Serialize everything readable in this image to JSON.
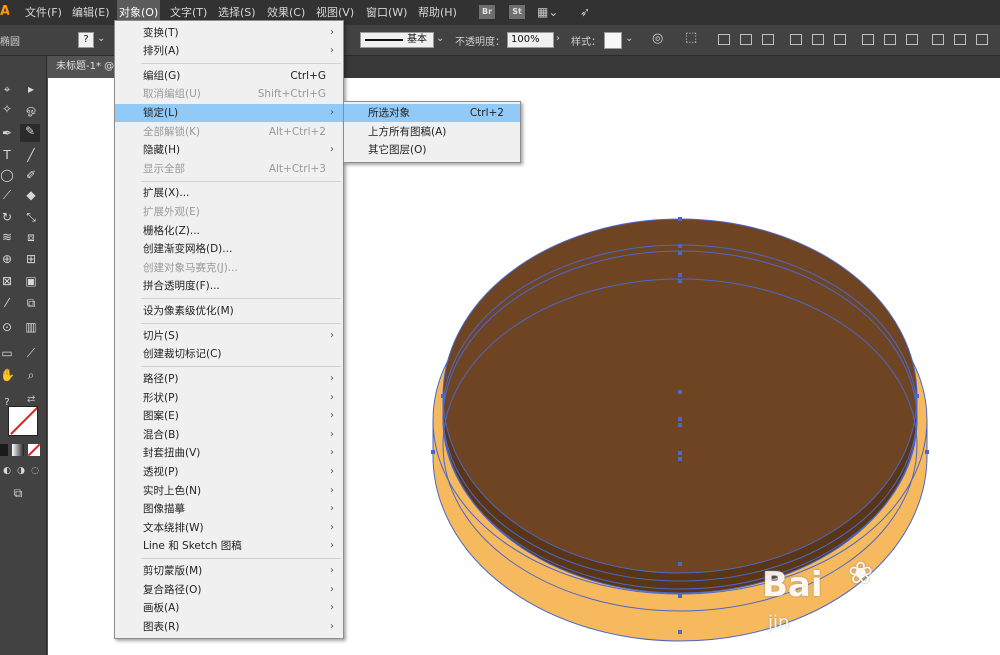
{
  "app": {
    "logo": "Ai"
  },
  "menubar": {
    "items": [
      "文件(F)",
      "编辑(E)",
      "对象(O)",
      "文字(T)",
      "选择(S)",
      "效果(C)",
      "视图(V)",
      "窗口(W)",
      "帮助(H)"
    ],
    "bridge": "Br",
    "stock": "St"
  },
  "control_bar": {
    "tool_label": "椭圆",
    "stroke_style": "基本",
    "opacity_label": "不透明度：",
    "opacity_value": "100%",
    "style_label": "样式："
  },
  "tab": {
    "title": "未标题-1* @"
  },
  "object_menu": {
    "items": [
      {
        "label": "变换(T)",
        "shortcut": "",
        "submenu": true,
        "disabled": false
      },
      {
        "label": "排列(A)",
        "shortcut": "",
        "submenu": true,
        "disabled": false
      },
      {
        "label": "编组(G)",
        "shortcut": "Ctrl+G",
        "submenu": false,
        "disabled": false
      },
      {
        "label": "取消编组(U)",
        "shortcut": "Shift+Ctrl+G",
        "submenu": false,
        "disabled": true
      },
      {
        "label": "锁定(L)",
        "shortcut": "",
        "submenu": true,
        "disabled": false,
        "highlight": true
      },
      {
        "label": "全部解锁(K)",
        "shortcut": "Alt+Ctrl+2",
        "submenu": false,
        "disabled": true
      },
      {
        "label": "隐藏(H)",
        "shortcut": "",
        "submenu": true,
        "disabled": false
      },
      {
        "label": "显示全部",
        "shortcut": "Alt+Ctrl+3",
        "submenu": false,
        "disabled": true
      },
      {
        "label": "扩展(X)...",
        "shortcut": "",
        "submenu": false,
        "disabled": false
      },
      {
        "label": "扩展外观(E)",
        "shortcut": "",
        "submenu": false,
        "disabled": true
      },
      {
        "label": "栅格化(Z)...",
        "shortcut": "",
        "submenu": false,
        "disabled": false
      },
      {
        "label": "创建渐变网格(D)...",
        "shortcut": "",
        "submenu": false,
        "disabled": false
      },
      {
        "label": "创建对象马赛克(J)...",
        "shortcut": "",
        "submenu": false,
        "disabled": true
      },
      {
        "label": "拼合透明度(F)...",
        "shortcut": "",
        "submenu": false,
        "disabled": false
      },
      {
        "label": "设为像素级优化(M)",
        "shortcut": "",
        "submenu": false,
        "disabled": false
      },
      {
        "label": "切片(S)",
        "shortcut": "",
        "submenu": true,
        "disabled": false
      },
      {
        "label": "创建裁切标记(C)",
        "shortcut": "",
        "submenu": false,
        "disabled": false
      },
      {
        "label": "路径(P)",
        "shortcut": "",
        "submenu": true,
        "disabled": false
      },
      {
        "label": "形状(P)",
        "shortcut": "",
        "submenu": true,
        "disabled": false
      },
      {
        "label": "图案(E)",
        "shortcut": "",
        "submenu": true,
        "disabled": false
      },
      {
        "label": "混合(B)",
        "shortcut": "",
        "submenu": true,
        "disabled": false
      },
      {
        "label": "封套扭曲(V)",
        "shortcut": "",
        "submenu": true,
        "disabled": false
      },
      {
        "label": "透视(P)",
        "shortcut": "",
        "submenu": true,
        "disabled": false
      },
      {
        "label": "实时上色(N)",
        "shortcut": "",
        "submenu": true,
        "disabled": false
      },
      {
        "label": "图像描摹",
        "shortcut": "",
        "submenu": true,
        "disabled": false
      },
      {
        "label": "文本绕排(W)",
        "shortcut": "",
        "submenu": true,
        "disabled": false
      },
      {
        "label": "Line 和 Sketch 图稿",
        "shortcut": "",
        "submenu": true,
        "disabled": false
      },
      {
        "label": "剪切蒙版(M)",
        "shortcut": "",
        "submenu": true,
        "disabled": false
      },
      {
        "label": "复合路径(O)",
        "shortcut": "",
        "submenu": true,
        "disabled": false
      },
      {
        "label": "画板(A)",
        "shortcut": "",
        "submenu": true,
        "disabled": false
      },
      {
        "label": "图表(R)",
        "shortcut": "",
        "submenu": true,
        "disabled": false
      }
    ]
  },
  "lock_submenu": {
    "items": [
      {
        "label": "所选对象",
        "shortcut": "Ctrl+2",
        "highlight": true
      },
      {
        "label": "上方所有图稿(A)",
        "shortcut": ""
      },
      {
        "label": "其它图层(O)",
        "shortcut": ""
      }
    ]
  },
  "colors": {
    "lid_top": "#6f4423",
    "lid_side": "#5a3516",
    "base": "#f6b95d",
    "selection": "#4a68c9",
    "highlight": "#91c9f7"
  },
  "watermark": {
    "brand": "Bai",
    "sub": "jin"
  }
}
